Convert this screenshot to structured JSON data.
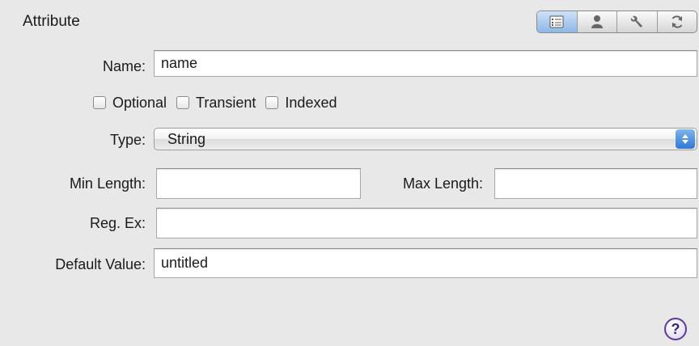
{
  "header": {
    "title": "Attribute"
  },
  "toolbar": {
    "tabs": [
      {
        "icon": "properties-icon",
        "active": true
      },
      {
        "icon": "user-info-icon",
        "active": false
      },
      {
        "icon": "wrench-icon",
        "active": false
      },
      {
        "icon": "sync-icon",
        "active": false
      }
    ]
  },
  "form": {
    "name": {
      "label": "Name:",
      "value": "name"
    },
    "checkboxes": [
      {
        "label": "Optional",
        "checked": false
      },
      {
        "label": "Transient",
        "checked": false
      },
      {
        "label": "Indexed",
        "checked": false
      }
    ],
    "type": {
      "label": "Type:",
      "value": "String"
    },
    "min_length": {
      "label": "Min Length:",
      "value": ""
    },
    "max_length": {
      "label": "Max Length:",
      "value": ""
    },
    "regex": {
      "label": "Reg. Ex:",
      "value": ""
    },
    "default_value": {
      "label": "Default Value:",
      "value": "untitled"
    }
  },
  "help": {
    "symbol": "?"
  },
  "colors": {
    "accent": "#2f78d6",
    "help": "#5e3a9a",
    "background": "#e8e8e8"
  }
}
